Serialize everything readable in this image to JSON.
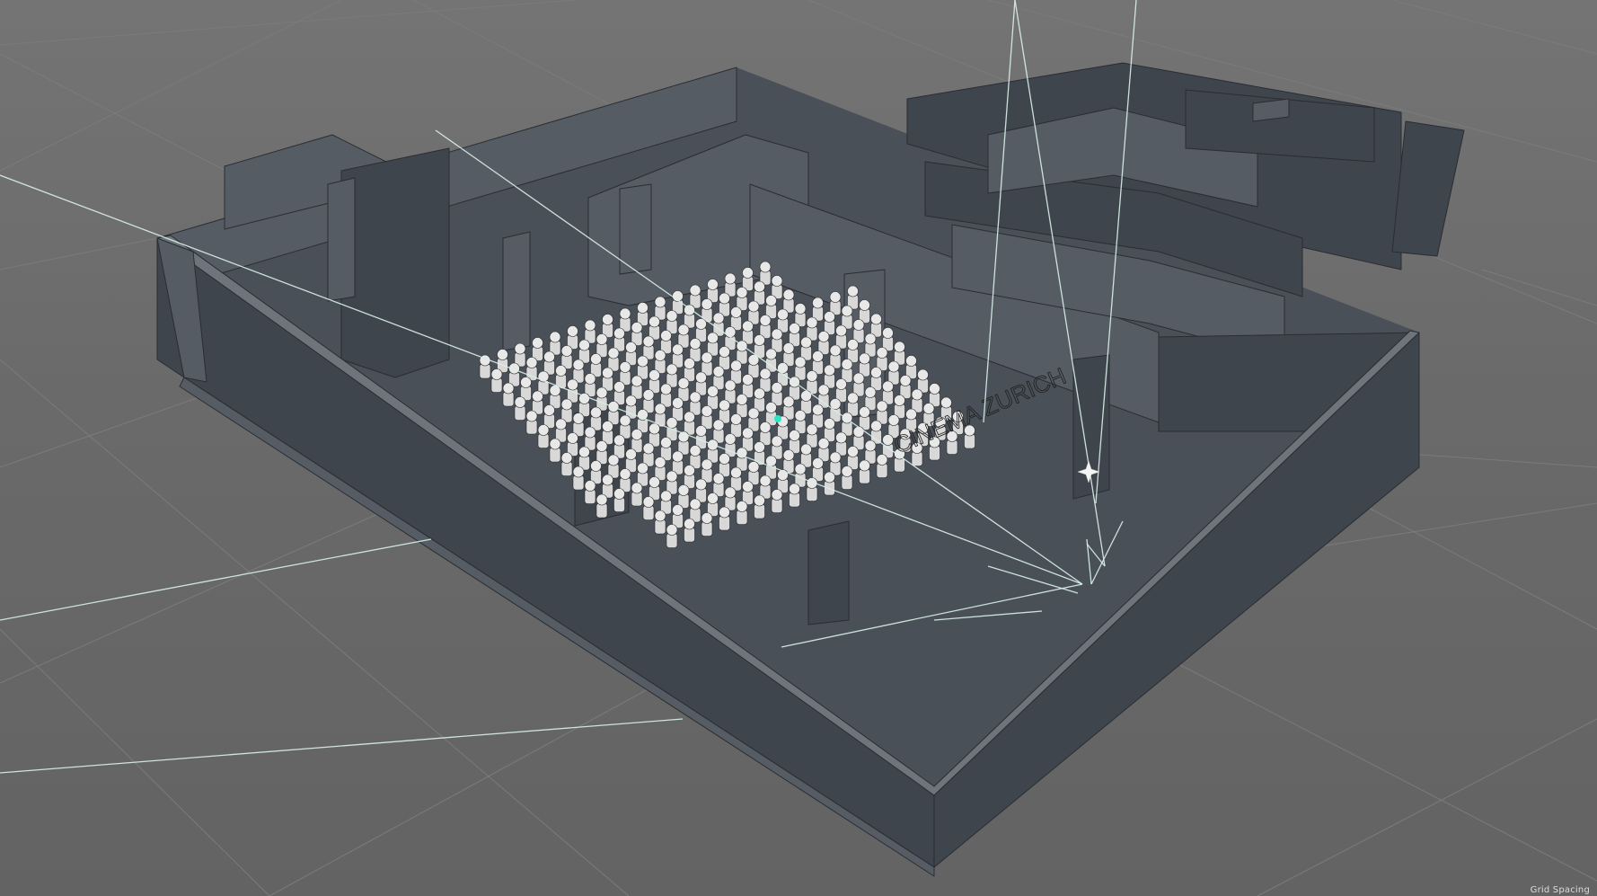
{
  "viewport": {
    "grid_label": "Grid Spacing",
    "view_type": "perspective",
    "background": "#6b6b6b",
    "accent_colors": {
      "light_rays": "#d8efe8",
      "selected_point": "#2ee6c7",
      "model_gray": "#565c64"
    }
  },
  "scene": {
    "object_label": "CINEMA ZURICH",
    "seat_rows": 14,
    "seat_columns": 20
  }
}
